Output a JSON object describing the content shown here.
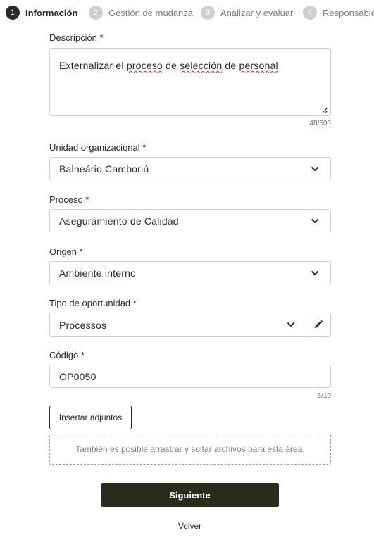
{
  "stepper": {
    "steps": [
      {
        "number": "1",
        "label": "Información"
      },
      {
        "number": "2",
        "label": "Gestión de mudanza"
      },
      {
        "number": "3",
        "label": "Analizar y evaluar"
      },
      {
        "number": "4",
        "label": "Responsables"
      }
    ],
    "active_index": 0
  },
  "form": {
    "description": {
      "label": "Descripción *",
      "value_parts": [
        "Externalizar el ",
        "proceso",
        " de ",
        "selección",
        " de ",
        "personal"
      ],
      "counter": "48/500"
    },
    "org_unit": {
      "label": "Unidad organizacional *",
      "value": "Balneário Camboriú"
    },
    "process": {
      "label": "Proceso *",
      "value": "Aseguramiento de Calidad"
    },
    "origin": {
      "label": "Origen *",
      "value": "Ambiente interno"
    },
    "opportunity_type": {
      "label": "Tipo de oportunidad *",
      "value": "Processos"
    },
    "code": {
      "label": "Código *",
      "value": "OP0050",
      "counter": "6/10"
    }
  },
  "attachments": {
    "button_label": "Insertar adjuntos",
    "dropzone_text": "También es posible arrastrar y soltar archivos para esta área."
  },
  "actions": {
    "next_label": "Siguiente",
    "back_label": "Volver"
  },
  "icons": {
    "dropdown": "chevron-down-icon",
    "edit": "pencil-icon",
    "resize": "resize-grip-icon"
  },
  "colors": {
    "primary_dark": "#2b2a1f",
    "active_step": "#2b2a24",
    "inactive_step": "#cfcfcf",
    "spellcheck": "#d32f2f"
  }
}
